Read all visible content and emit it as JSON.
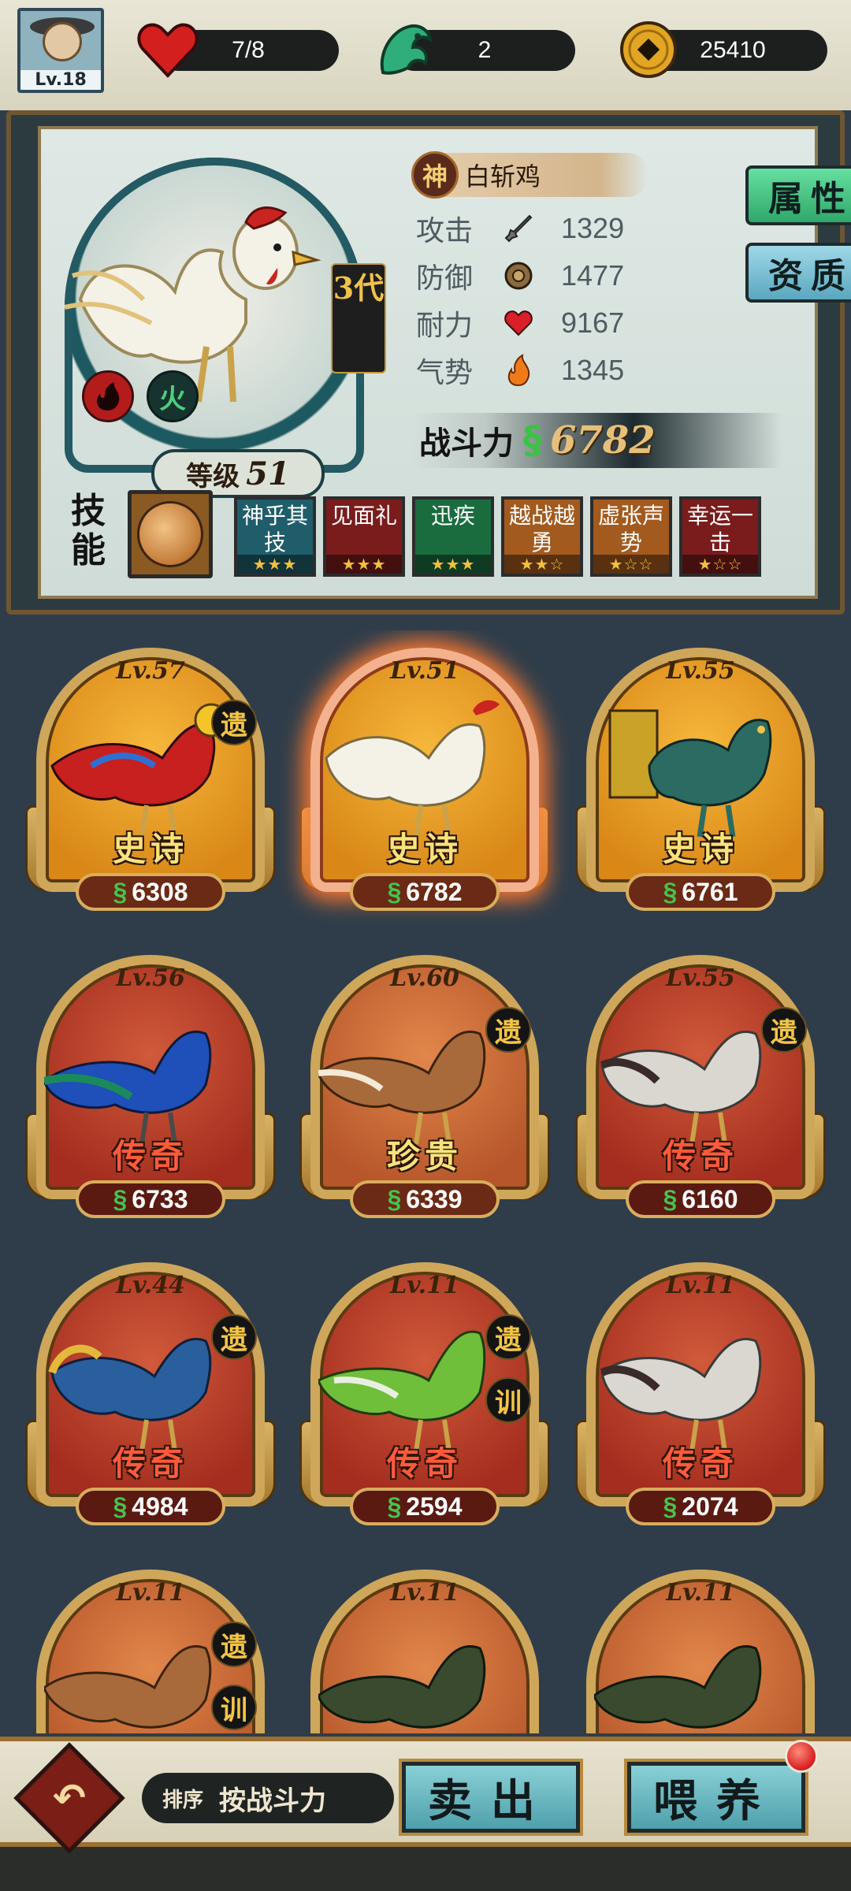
{
  "top": {
    "level_label": "Lv.18",
    "stamina": "7/8",
    "spirit": "2",
    "coins": "25410"
  },
  "profile": {
    "generation": "3代",
    "rank_icon": "神",
    "name": "白斩鸡",
    "element1": "fire-icon",
    "element2": "火",
    "level_label": "等级",
    "level": "51",
    "stats": [
      {
        "label": "攻击",
        "icon": "sword-icon",
        "value": "1329"
      },
      {
        "label": "防御",
        "icon": "shield-icon",
        "value": "1477"
      },
      {
        "label": "耐力",
        "icon": "heart-icon",
        "value": "9167"
      },
      {
        "label": "气势",
        "icon": "flame-icon",
        "value": "1345"
      }
    ],
    "power_label": "战斗力",
    "power": "6782",
    "tab_attr": "属性",
    "tab_quality": "资质",
    "skill_label": "技能",
    "skills": [
      {
        "name": "神乎其技",
        "stars": 3,
        "color": "blue"
      },
      {
        "name": "见面礼",
        "stars": 3,
        "color": "red"
      },
      {
        "name": "迅疾",
        "stars": 3,
        "color": "green"
      },
      {
        "name": "越战越勇",
        "stars": 2,
        "color": "orange"
      },
      {
        "name": "虚张声势",
        "stars": 1,
        "color": "orange"
      },
      {
        "name": "幸运一击",
        "stars": 1,
        "color": "red"
      }
    ]
  },
  "cards": [
    {
      "level": "Lv.57",
      "rarity": "史诗",
      "power": "6308",
      "tags": [
        "遗"
      ]
    },
    {
      "level": "Lv.51",
      "rarity": "史诗",
      "power": "6782",
      "tags": []
    },
    {
      "level": "Lv.55",
      "rarity": "史诗",
      "power": "6761",
      "tags": []
    },
    {
      "level": "Lv.56",
      "rarity": "传奇",
      "power": "6733",
      "tags": []
    },
    {
      "level": "Lv.60",
      "rarity": "珍贵",
      "power": "6339",
      "tags": [
        "遗"
      ]
    },
    {
      "level": "Lv.55",
      "rarity": "传奇",
      "power": "6160",
      "tags": [
        "遗"
      ]
    },
    {
      "level": "Lv.44",
      "rarity": "传奇",
      "power": "4984",
      "tags": [
        "遗"
      ]
    },
    {
      "level": "Lv.11",
      "rarity": "传奇",
      "power": "2594",
      "tags": [
        "遗",
        "训"
      ]
    },
    {
      "level": "Lv.11",
      "rarity": "传奇",
      "power": "2074",
      "tags": []
    },
    {
      "level": "Lv.11",
      "rarity": "",
      "power": "",
      "tags": [
        "遗",
        "训"
      ]
    },
    {
      "level": "Lv.11",
      "rarity": "",
      "power": "",
      "tags": []
    },
    {
      "level": "Lv.11",
      "rarity": "",
      "power": "",
      "tags": []
    }
  ],
  "bottom": {
    "sort_label": "排序",
    "sort_value": "按战斗力",
    "sell": "卖出",
    "feed": "喂养"
  }
}
